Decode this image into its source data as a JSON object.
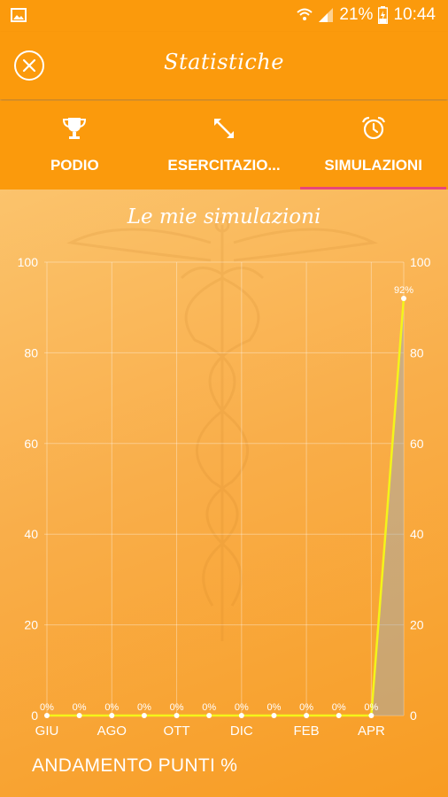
{
  "statusbar": {
    "battery_percent": "21%",
    "time": "10:44"
  },
  "header": {
    "title": "Statistiche",
    "close_icon": "close-circle-icon"
  },
  "tabs": [
    {
      "label": "PODIO",
      "icon": "trophy-icon",
      "active": false
    },
    {
      "label": "ESERCITAZIO...",
      "icon": "resize-arrows-icon",
      "active": false
    },
    {
      "label": "SIMULAZIONI",
      "icon": "alarm-clock-icon",
      "active": true
    }
  ],
  "colors": {
    "accent": "#fb9a0c",
    "tab_indicator": "#e8467a",
    "line": "#f4f41a"
  },
  "chart_data": {
    "type": "line",
    "title": "Le mie simulazioni",
    "ylim": [
      0,
      100
    ],
    "y_ticks": [
      "100",
      "80",
      "60",
      "40",
      "20",
      "0"
    ],
    "x_tick_labels": [
      "GIU",
      "AGO",
      "OTT",
      "DIC",
      "FEB",
      "APR"
    ],
    "points": [
      0,
      0,
      0,
      0,
      0,
      0,
      0,
      0,
      0,
      0,
      0,
      92
    ],
    "point_labels": [
      "0%",
      "0%",
      "0%",
      "0%",
      "0%",
      "0%",
      "0%",
      "0%",
      "0%",
      "0%",
      "0%",
      "92%"
    ],
    "grid": true
  },
  "footer": {
    "label": "ANDAMENTO PUNTI %"
  }
}
